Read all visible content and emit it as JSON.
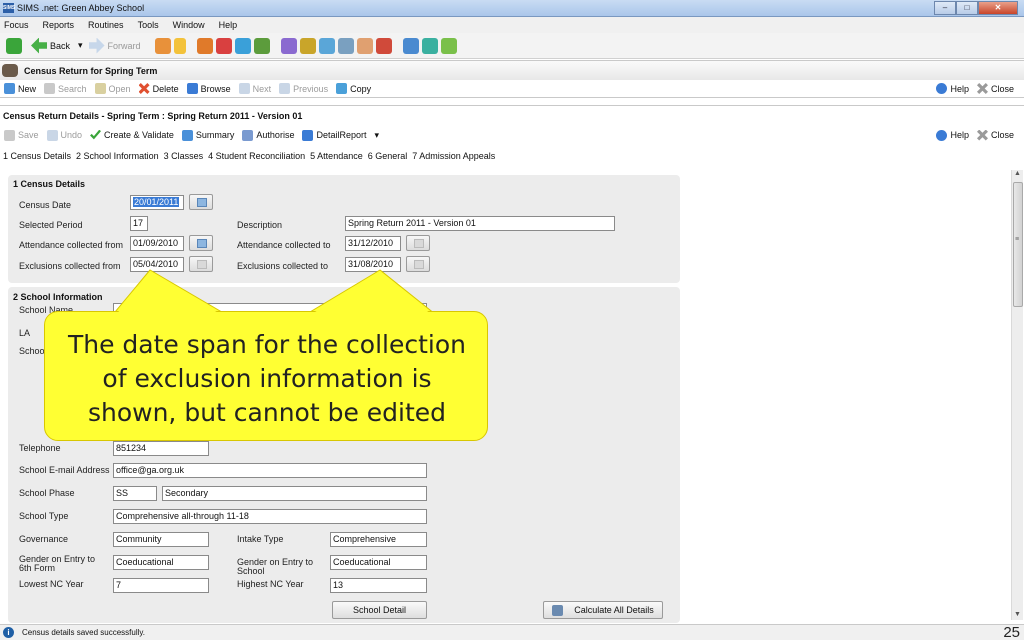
{
  "window": {
    "title": "SIMS .net: Green Abbey School",
    "app_icon": "SIMS"
  },
  "menu": [
    "Focus",
    "Reports",
    "Routines",
    "Tools",
    "Window",
    "Help"
  ],
  "toolbar": {
    "back": "Back",
    "forward": "Forward"
  },
  "panel": {
    "title": "Census Return for Spring Term"
  },
  "actions": {
    "new": "New",
    "search": "Search",
    "open": "Open",
    "delete": "Delete",
    "browse": "Browse",
    "next": "Next",
    "previous": "Previous",
    "copy": "Copy",
    "help": "Help",
    "close": "Close"
  },
  "details_panel": {
    "title": "Census Return Details - Spring Term : Spring Return 2011 - Version 01",
    "save": "Save",
    "undo": "Undo",
    "create_validate": "Create & Validate",
    "summary": "Summary",
    "authorise": "Authorise",
    "detail_report": "DetailReport",
    "help": "Help",
    "close": "Close"
  },
  "nav": [
    "1 Census Details",
    "2 School Information",
    "3 Classes",
    "4 Student Reconciliation",
    "5 Attendance",
    "6 General",
    "7 Admission Appeals"
  ],
  "census": {
    "heading": "1 Census Details",
    "census_date_label": "Census Date",
    "census_date": "20/01/2011",
    "period_label": "Selected Period",
    "period": "17",
    "description_label": "Description",
    "description": "Spring Return 2011 - Version 01",
    "att_from_label": "Attendance collected from",
    "att_from": "01/09/2010",
    "att_to_label": "Attendance collected to",
    "att_to": "31/12/2010",
    "exc_from_label": "Exclusions collected from",
    "exc_from": "05/04/2010",
    "exc_to_label": "Exclusions collected to",
    "exc_to": "31/08/2010"
  },
  "school": {
    "heading": "2 School Information",
    "name_label": "School Name",
    "la_label": "LA",
    "school_label": "Schoo",
    "telephone_label": "Telephone",
    "telephone": "851234",
    "email_label": "School E-mail Address",
    "email": "office@ga.org.uk",
    "phase_label": "School Phase",
    "phase_code": "SS",
    "phase": "Secondary",
    "type_label": "School Type",
    "type": "Comprehensive all-through 11-18",
    "governance_label": "Governance",
    "governance": "Community",
    "intake_label": "Intake Type",
    "intake": "Comprehensive",
    "gender6_label": "Gender on Entry to 6th Form",
    "gender6": "Coeducational",
    "gender_school_label": "Gender on Entry to School",
    "gender_school": "Coeducational",
    "lowest_label": "Lowest NC Year",
    "lowest": "7",
    "highest_label": "Highest NC Year",
    "highest": "13",
    "school_detail_btn": "School Detail",
    "calculate_btn": "Calculate All Details"
  },
  "callout": {
    "text": "The date span for the collection of exclusion information is shown, but cannot be edited"
  },
  "status": {
    "text": "Census details saved successfully."
  },
  "page_number": "25"
}
